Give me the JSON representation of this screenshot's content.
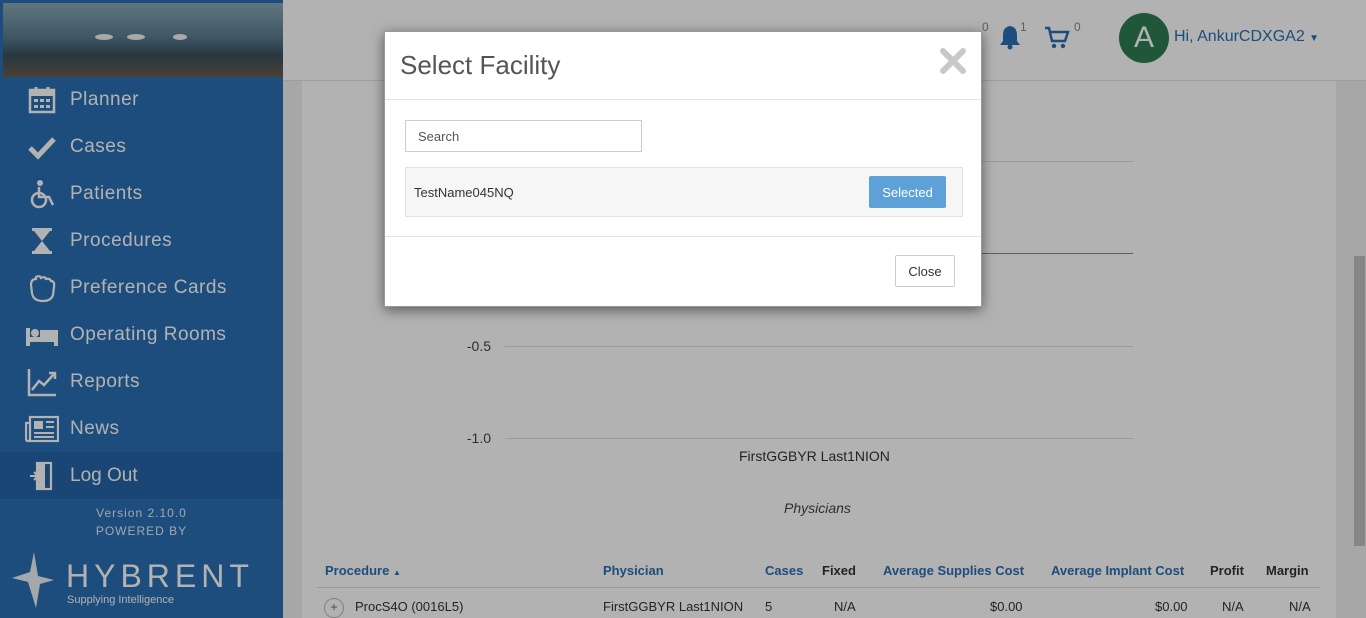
{
  "sidebar": {
    "items": [
      {
        "label": "Planner",
        "icon": "calendar-icon"
      },
      {
        "label": "Cases",
        "icon": "check-icon"
      },
      {
        "label": "Patients",
        "icon": "wheelchair-icon"
      },
      {
        "label": "Procedures",
        "icon": "hourglass-icon"
      },
      {
        "label": "Preference Cards",
        "icon": "glove-icon"
      },
      {
        "label": "Operating Rooms",
        "icon": "bed-icon"
      },
      {
        "label": "Reports",
        "icon": "chart-line-icon"
      },
      {
        "label": "News",
        "icon": "newspaper-icon"
      }
    ],
    "logout": "Log Out",
    "version": "Version 2.10.0",
    "powered_by": "POWERED BY",
    "brand": "HYBRENT",
    "brand_tag": "Supplying Intelligence"
  },
  "header": {
    "greeting": "Hi, AnkurCDXGA2",
    "avatar_letter": "A",
    "messages_count": "0",
    "notifications_count": "1",
    "cart_count": "0"
  },
  "chart": {
    "y_ticks": [
      "-0.5",
      "-1.0"
    ],
    "category": "FirstGGBYR Last1NION",
    "x_label": "Physicians"
  },
  "table": {
    "headers": [
      "Procedure",
      "Physician",
      "Cases",
      "Fixed",
      "Average Supplies Cost",
      "Average Implant Cost",
      "Profit",
      "Margin"
    ],
    "rows": [
      [
        "ProcS4O (0016L5)",
        "FirstGGBYR Last1NION",
        "5",
        "N/A",
        "$0.00",
        "$0.00",
        "N/A",
        "N/A"
      ]
    ],
    "sort_indicator": "▲"
  },
  "modal": {
    "title": "Select Facility",
    "search_placeholder": "Search",
    "facility_name": "TestName045NQ",
    "selected_label": "Selected",
    "close_label": "Close"
  }
}
